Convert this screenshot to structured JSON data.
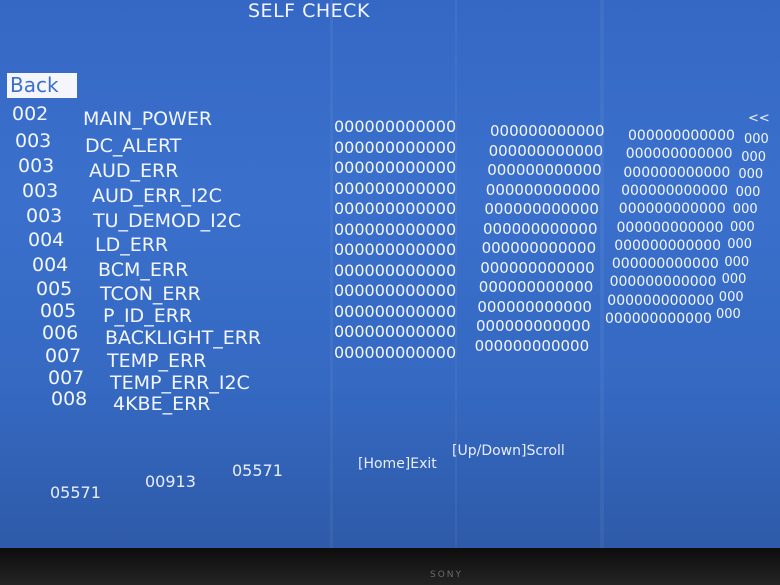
{
  "title": "SELF CHECK",
  "back_label": "Back",
  "scroll_marker": "<<",
  "rows": [
    {
      "code": "002",
      "name": "MAIN_POWER",
      "v1": "",
      "v2": "",
      "v3": "",
      "v4": ""
    },
    {
      "code": "003",
      "name": "DC_ALERT",
      "v1": "000000000000",
      "v2": "000000000000",
      "v3": "000000000000",
      "v4": "000"
    },
    {
      "code": "003",
      "name": "AUD_ERR",
      "v1": "000000000000",
      "v2": "000000000000",
      "v3": "000000000000",
      "v4": "000"
    },
    {
      "code": "003",
      "name": "AUD_ERR_I2C",
      "v1": "000000000000",
      "v2": "000000000000",
      "v3": "000000000000",
      "v4": "000"
    },
    {
      "code": "003",
      "name": "TU_DEMOD_I2C",
      "v1": "000000000000",
      "v2": "000000000000",
      "v3": "000000000000",
      "v4": "000"
    },
    {
      "code": "004",
      "name": "LD_ERR",
      "v1": "000000000000",
      "v2": "000000000000",
      "v3": "000000000000",
      "v4": "000"
    },
    {
      "code": "004",
      "name": "BCM_ERR",
      "v1": "000000000000",
      "v2": "000000000000",
      "v3": "000000000000",
      "v4": "000"
    },
    {
      "code": "005",
      "name": "TCON_ERR",
      "v1": "000000000000",
      "v2": "000000000000",
      "v3": "000000000000",
      "v4": "000"
    },
    {
      "code": "005",
      "name": "P_ID_ERR",
      "v1": "000000000000",
      "v2": "000000000000",
      "v3": "000000000000",
      "v4": "000"
    },
    {
      "code": "006",
      "name": "BACKLIGHT_ERR",
      "v1": "000000000000",
      "v2": "000000000000",
      "v3": "000000000000",
      "v4": "000"
    },
    {
      "code": "007",
      "name": "TEMP_ERR",
      "v1": "000000000000",
      "v2": "000000000000",
      "v3": "000000000000",
      "v4": "000"
    },
    {
      "code": "007",
      "name": "TEMP_ERR_I2C",
      "v1": "000000000000",
      "v2": "000000000000",
      "v3": "000000000000",
      "v4": "000"
    },
    {
      "code": "008",
      "name": "4KBE_ERR",
      "v1": "000000000000",
      "v2": "000000000000",
      "v3": "",
      "v4": ""
    }
  ],
  "footer": {
    "num1": "05571",
    "num2": "00913",
    "num3": "05571",
    "exit_hint": "[Home]Exit",
    "scroll_hint": "[Up/Down]Scroll"
  },
  "brand": "SONY"
}
